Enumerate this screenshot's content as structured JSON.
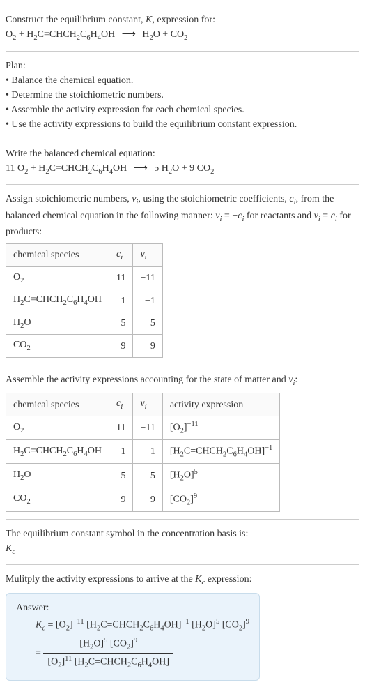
{
  "intro": {
    "line1_a": "Construct the equilibrium constant, ",
    "line1_b": ", expression for:",
    "K": "K",
    "eq_lhs_a": "O",
    "eq_lhs_b": " + H",
    "eq_lhs_c": "C=CHCH",
    "eq_lhs_d": "C",
    "eq_lhs_e": "H",
    "eq_lhs_f": "OH",
    "arrow": "⟶",
    "eq_rhs_a": "H",
    "eq_rhs_b": "O + CO"
  },
  "plan": {
    "header": "Plan:",
    "b1": "• Balance the chemical equation.",
    "b2": "• Determine the stoichiometric numbers.",
    "b3": "• Assemble the activity expression for each chemical species.",
    "b4": "• Use the activity expressions to build the equilibrium constant expression."
  },
  "balanced": {
    "header": "Write the balanced chemical equation:",
    "c1": "11 O",
    "c2": " + H",
    "c3": "C=CHCH",
    "c4": "C",
    "c5": "H",
    "c6": "OH",
    "arrow": "⟶",
    "c7": "5 H",
    "c8": "O + 9 CO"
  },
  "stoich": {
    "p1": "Assign stoichiometric numbers, ",
    "nu": "ν",
    "sub_i": "i",
    "p2": ", using the stoichiometric coefficients, ",
    "c": "c",
    "p3": ", from the balanced chemical equation in the following manner: ",
    "rel1a": " = −",
    "p4": " for reactants and ",
    "rel2a": " = ",
    "p5": " for products:",
    "h_species": "chemical species",
    "h_c": "c",
    "h_nu": "ν",
    "rows": [
      {
        "sp_a": "O",
        "sp_b": "",
        "c": "11",
        "nu": "−11"
      },
      {
        "sp_a": "H",
        "sp_b": "C=CHCH",
        "sp_c": "C",
        "sp_d": "H",
        "sp_e": "OH",
        "c": "1",
        "nu": "−1"
      },
      {
        "sp_a": "H",
        "sp_b": "O",
        "c": "5",
        "nu": "5"
      },
      {
        "sp_a": "CO",
        "sp_b": "",
        "c": "9",
        "nu": "9"
      }
    ]
  },
  "activity": {
    "p1": "Assemble the activity expressions accounting for the state of matter and ",
    "nu": "ν",
    "sub_i": "i",
    "p2": ":",
    "h_species": "chemical species",
    "h_c": "c",
    "h_nu": "ν",
    "h_act": "activity expression",
    "rows": [
      {
        "c": "11",
        "nu": "−11",
        "exp": "−11"
      },
      {
        "c": "1",
        "nu": "−1",
        "exp": "−1"
      },
      {
        "c": "5",
        "nu": "5",
        "exp": "5"
      },
      {
        "c": "9",
        "nu": "9",
        "exp": "9"
      }
    ]
  },
  "symbol": {
    "p1": "The equilibrium constant symbol in the concentration basis is:",
    "Kc": "K",
    "sub_c": "c"
  },
  "multiply": {
    "p1": "Mulitply the activity expressions to arrive at the ",
    "Kc": "K",
    "sub_c": "c",
    "p2": " expression:"
  },
  "answer": {
    "label": "Answer:",
    "Kc": "K",
    "sub_c": "c",
    "eq": " = ",
    "o2exp": "−11",
    "chavexp": "−1",
    "h2oexp": "5",
    "co2exp": "9",
    "o2den": "11"
  },
  "nums": {
    "two": "2",
    "four": "4",
    "six": "6"
  }
}
